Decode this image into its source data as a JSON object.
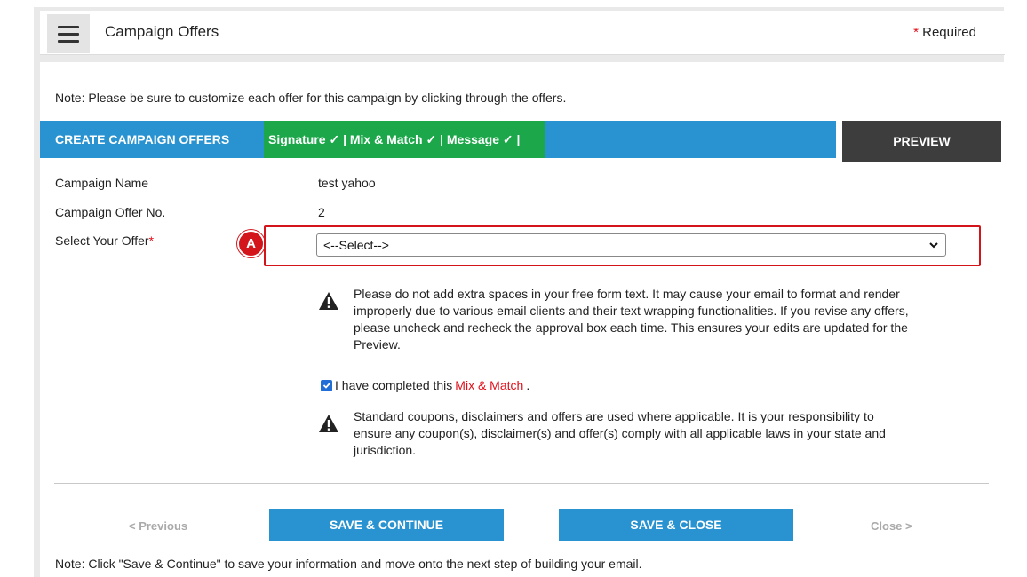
{
  "header": {
    "title": "Campaign Offers",
    "required_star": "*",
    "required_label": "Required"
  },
  "note_top": {
    "label": "Note:",
    "text": "Please be sure to customize each offer for this campaign by clicking through the offers."
  },
  "tabs": {
    "create": "CREATE CAMPAIGN OFFERS",
    "status": "Signature ✓ | Mix & Match ✓ | Message ✓ |",
    "preview": "PREVIEW"
  },
  "form": {
    "campaign_name_label": "Campaign Name",
    "campaign_name_value": "test yahoo",
    "offer_no_label": "Campaign Offer No.",
    "offer_no_value": "2",
    "select_offer_label": "Select Your Offer",
    "select_offer_star": "*",
    "select_offer_value": "<--Select-->"
  },
  "annotation": {
    "badge": "A"
  },
  "warnings": {
    "first": "Please do not add extra spaces in your free form text. It may cause your email to format and render improperly due to various email clients and their text wrapping functionalities. If you revise any offers, please uncheck and recheck the approval box each time. This ensures your edits are updated for the Preview.",
    "second": "Standard coupons, disclaimers and offers are used where applicable. It is your responsibility to ensure any coupon(s), disclaimer(s) and offer(s) comply with all applicable laws in your state and jurisdiction."
  },
  "confirmation": {
    "checked": true,
    "prefix": "I have completed this",
    "link": "Mix & Match",
    "suffix": "."
  },
  "buttons": {
    "previous": "< Previous",
    "save_continue": "SAVE & CONTINUE",
    "save_close": "SAVE & CLOSE",
    "close": "Close >"
  },
  "note_bottom": {
    "label": "Note:",
    "text": "Click \"Save & Continue\" to save your information and move onto the next step of building your email."
  },
  "colors": {
    "primary_blue": "#2993d1",
    "status_green": "#1ca84a",
    "preview_dark": "#3d3d3d",
    "required_red": "#e0101b"
  }
}
